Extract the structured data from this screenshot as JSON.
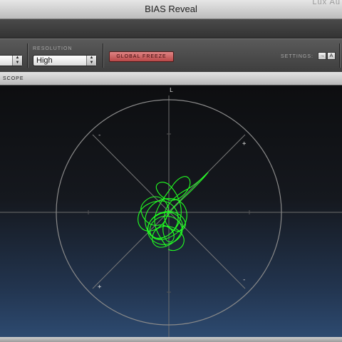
{
  "window": {
    "title": "BIAS Reveal",
    "ghost_text": "Lux Au"
  },
  "controls": {
    "left_select_value": "",
    "resolution_label": "RESOLUTION",
    "resolution_value": "High",
    "global_freeze_label": "GLOBAL FREEZE",
    "settings_label": "SETTINGS:",
    "settings_buttons": [
      "→",
      "A"
    ]
  },
  "scope": {
    "header_label": "SCOPE",
    "channel_label": "L",
    "marker_top_left": "-",
    "marker_top_right": "+",
    "marker_bottom_left": "+",
    "marker_bottom_right": "-",
    "trace_color": "#22ff22"
  }
}
